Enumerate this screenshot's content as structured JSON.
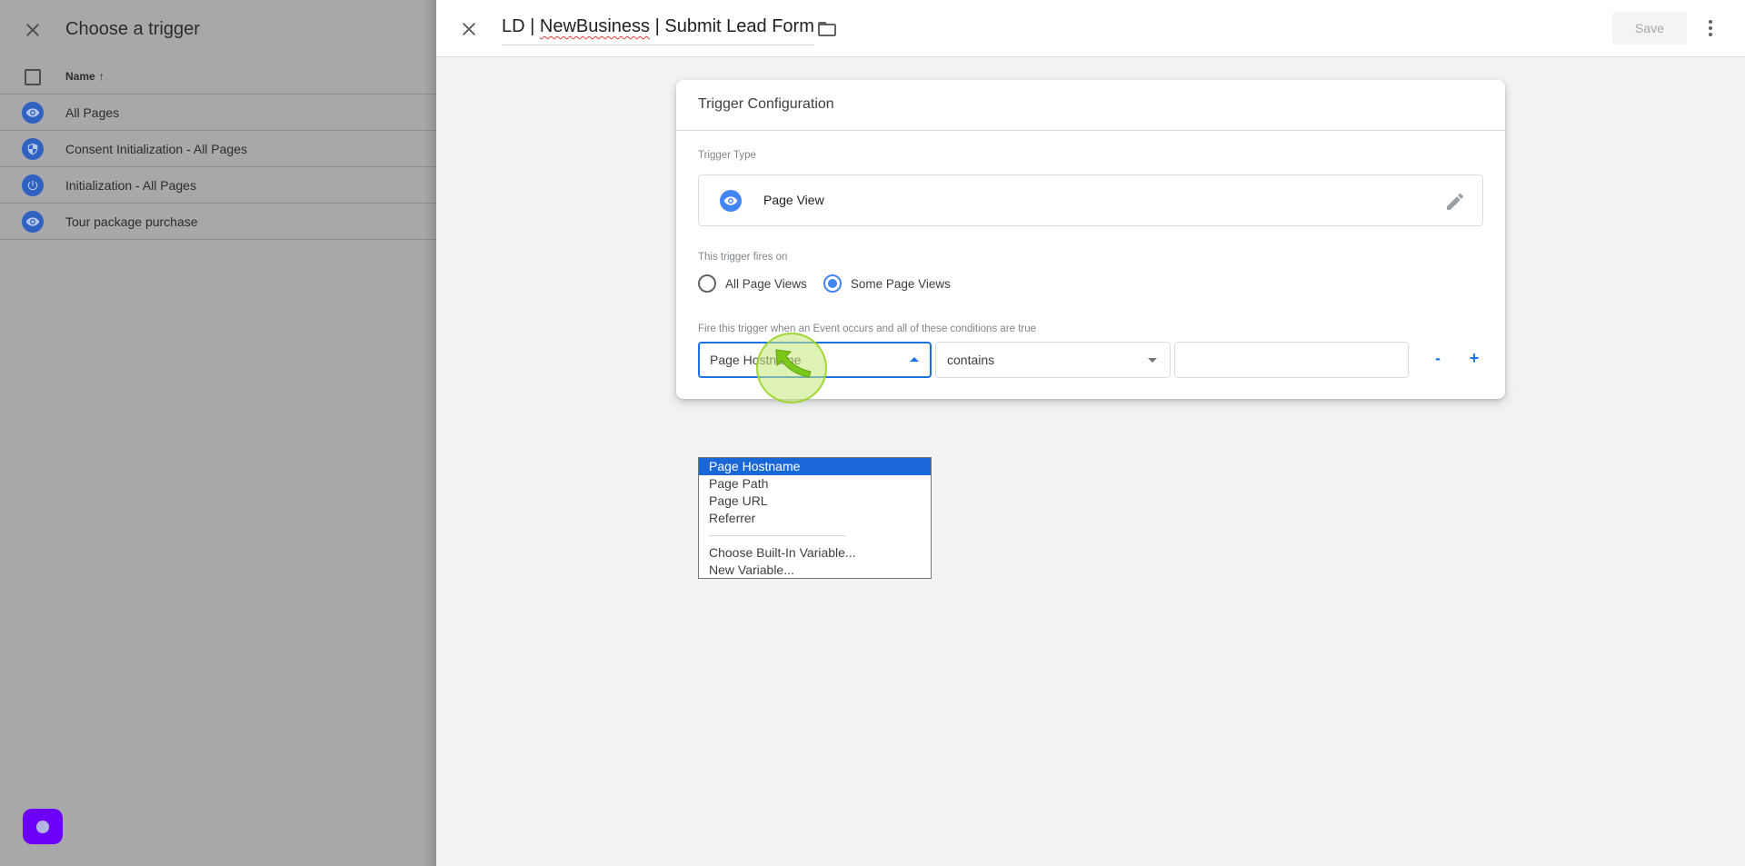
{
  "left_panel": {
    "title": "Choose a trigger",
    "close_icon": "close-icon",
    "table": {
      "column_header": "Name",
      "sort_indicator": "↑",
      "rows": [
        {
          "label": "All Pages",
          "icon": "eye-icon"
        },
        {
          "label": "Consent Initialization - All Pages",
          "icon": "shield-icon"
        },
        {
          "label": "Initialization - All Pages",
          "icon": "power-icon"
        },
        {
          "label": "Tour package purchase",
          "icon": "eye-icon"
        }
      ]
    },
    "help_button_icon": "help-bubble-icon"
  },
  "topbar": {
    "title_parts": [
      "LD | ",
      "NewBusiness",
      " | Submit Lead Form"
    ],
    "title": "LD | NewBusiness | Submit Lead Form",
    "save_label": "Save",
    "save_enabled": false,
    "more_icon": "more-vert-icon",
    "folder_icon": "folder-icon"
  },
  "trigger_config": {
    "card_title": "Trigger Configuration",
    "trigger_type_label": "Trigger Type",
    "trigger_type_value": "Page View",
    "fires_on_label": "This trigger fires on",
    "fires_on_options": [
      {
        "label": "All Page Views",
        "checked": false
      },
      {
        "label": "Some Page Views",
        "checked": true
      }
    ],
    "condition_label": "Fire this trigger when an Event occurs and all of these conditions are true",
    "condition": {
      "variable": "Page Hostname",
      "operator": "contains",
      "value": "",
      "remove_label": "-",
      "add_label": "+"
    }
  },
  "variable_dropdown": {
    "options": [
      {
        "label": "Page Hostname",
        "selected": true
      },
      {
        "label": "Page Path",
        "selected": false
      },
      {
        "label": "Page URL",
        "selected": false
      },
      {
        "label": "Referrer",
        "selected": false
      },
      {
        "separator": true
      },
      {
        "label": "Choose Built-In Variable...",
        "selected": false
      },
      {
        "label": "New Variable...",
        "selected": false
      }
    ]
  },
  "colors": {
    "accent": "#1a73e8",
    "trigger_icon_blue": "#4285f4",
    "dropdown_selected": "#1a68d8",
    "overlay_gray": "#a7a8aa",
    "help_purple": "#6d00f7",
    "main_bg": "#f1f2f4"
  }
}
